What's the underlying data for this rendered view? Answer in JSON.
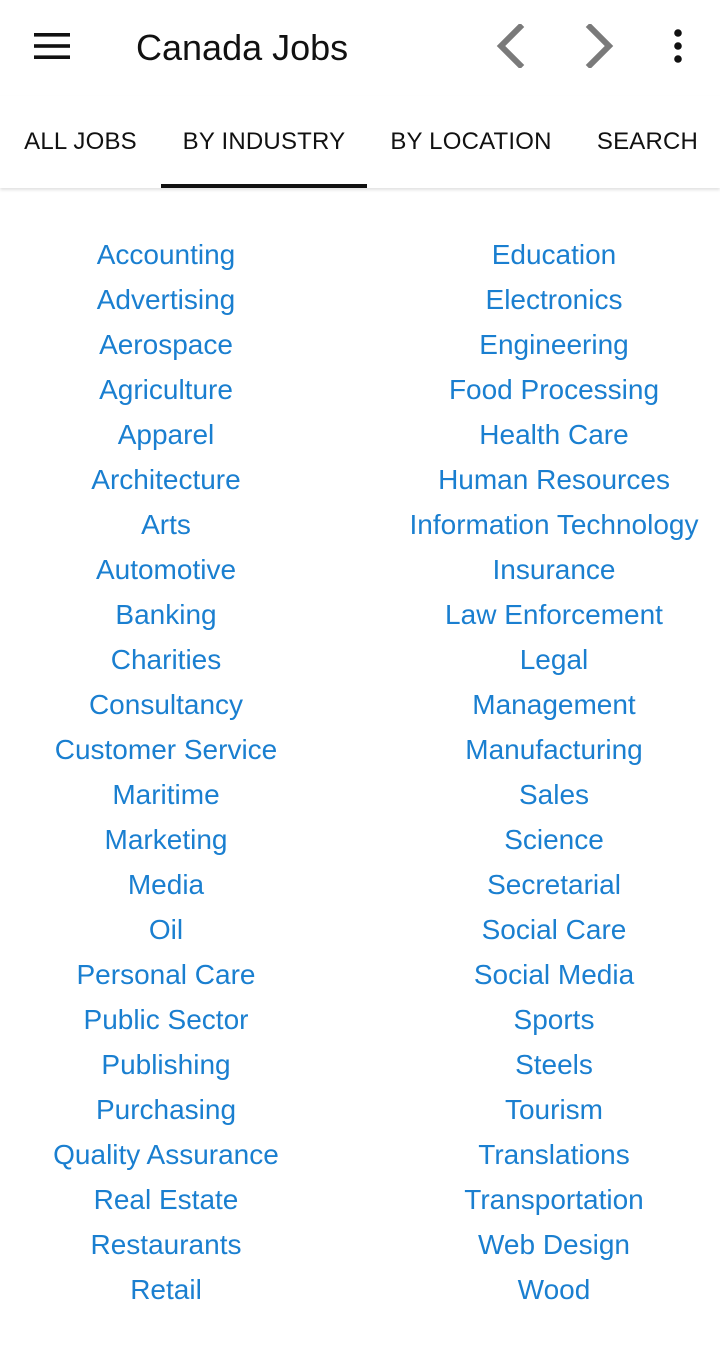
{
  "toolbar": {
    "title": "Canada Jobs",
    "menu_icon": "hamburger-menu-icon",
    "back_icon": "chevron-left-icon",
    "forward_icon": "chevron-right-icon",
    "more_icon": "more-vert-icon"
  },
  "tabs": [
    {
      "label": "ALL JOBS",
      "selected": false
    },
    {
      "label": "BY INDUSTRY",
      "selected": true
    },
    {
      "label": "BY LOCATION",
      "selected": false
    },
    {
      "label": "SEARCH",
      "selected": false
    }
  ],
  "industries": {
    "left": [
      "Accounting",
      "Advertising",
      "Aerospace",
      "Agriculture",
      "Apparel",
      "Architecture",
      "Arts",
      "Automotive",
      "Banking",
      "Charities",
      "Consultancy",
      "Customer Service",
      "Maritime",
      "Marketing",
      "Media",
      "Oil",
      "Personal Care",
      "Public Sector",
      "Publishing",
      "Purchasing",
      "Quality Assurance",
      "Real Estate",
      "Restaurants",
      "Retail"
    ],
    "right": [
      "Education",
      "Electronics",
      "Engineering",
      "Food Processing",
      "Health Care",
      "Human Resources",
      "Information Technology",
      "Insurance",
      "Law Enforcement",
      "Legal",
      "Management",
      "Manufacturing",
      "Sales",
      "Science",
      "Secretarial",
      "Social Care",
      "Social Media",
      "Sports",
      "Steels",
      "Tourism",
      "Translations",
      "Transportation",
      "Web Design",
      "Wood"
    ]
  },
  "colors": {
    "link": "#1a7fd0",
    "text": "#111111",
    "icon_disabled": "#7a7a7a",
    "background": "#ffffff"
  }
}
